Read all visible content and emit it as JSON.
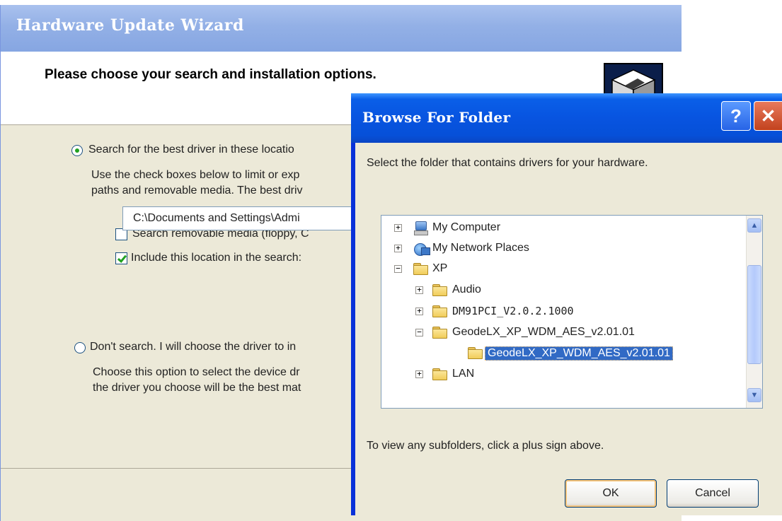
{
  "wizard": {
    "title": "Hardware Update Wizard",
    "heading": "Please choose your search and installation options.",
    "option_search_label": "Search for the best driver in these locatio",
    "search_desc_line1": "Use the check boxes below to limit or exp",
    "search_desc_line2": "paths and removable media. The best driv",
    "removable_label": "Search removable media (floppy, C",
    "include_label": "Include this location in the search:",
    "path_value": "C:\\Documents and Settings\\Admi",
    "option_dont_label": "Don't search. I will choose the driver to in",
    "dont_desc_line1": "Choose this option to select the device dr",
    "dont_desc_line2": "the driver you choose will be the best mat",
    "search_selected": true,
    "removable_checked": false,
    "include_checked": true
  },
  "browse": {
    "title": "Browse For Folder",
    "help_label": "?",
    "close_label": "✕",
    "prompt": "Select the folder that contains drivers for your hardware.",
    "tree": [
      {
        "label": "My Computer",
        "expander": "+",
        "icon": "computer-icon"
      },
      {
        "label": "My Network Places",
        "expander": "+",
        "icon": "network-places-icon"
      },
      {
        "label": "XP",
        "expander": "−",
        "icon": "folder-icon"
      },
      {
        "label": "Audio",
        "expander": "+",
        "icon": "folder-icon"
      },
      {
        "label": "DM91PCI_V2.0.2.1000",
        "expander": "+",
        "icon": "folder-icon"
      },
      {
        "label": "GeodeLX_XP_WDM_AES_v2.01.01",
        "expander": "−",
        "icon": "folder-icon"
      },
      {
        "label": "GeodeLX_XP_WDM_AES_v2.01.01",
        "expander": "",
        "icon": "folder-open-icon",
        "selected": true
      },
      {
        "label": "LAN",
        "expander": "+",
        "icon": "folder-icon"
      }
    ],
    "scroll_up": "▲",
    "scroll_down": "▼",
    "hint": "To view any subfolders, click a plus sign above.",
    "ok_label": "OK",
    "cancel_label": "Cancel"
  }
}
